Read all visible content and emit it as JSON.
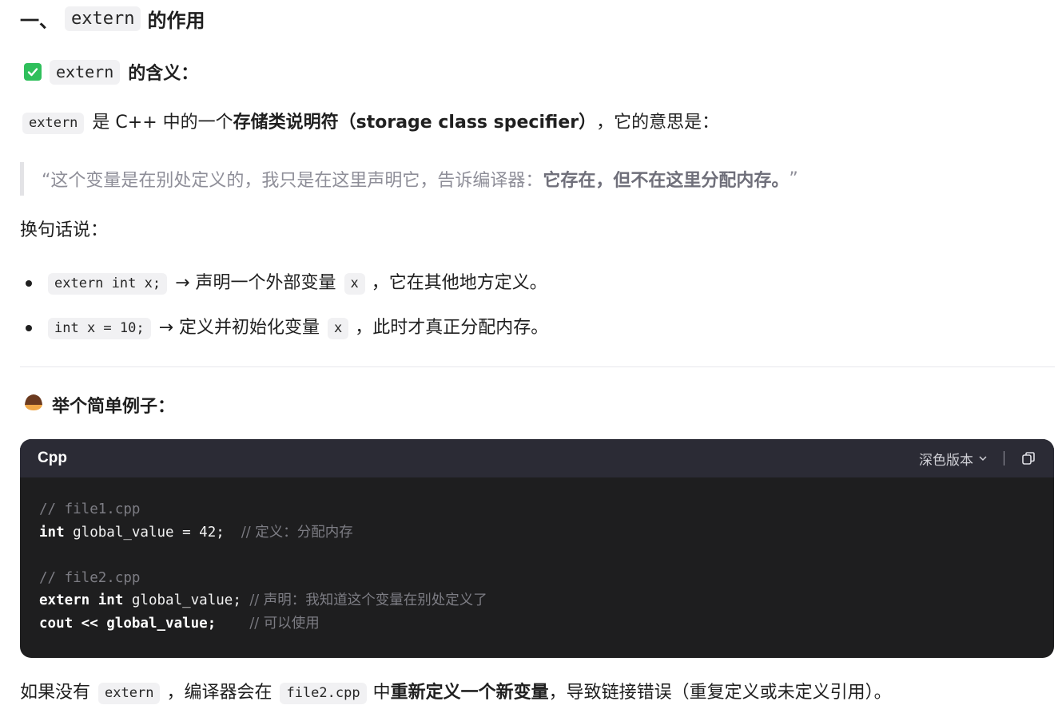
{
  "heading": {
    "prefix": "一、",
    "code": "extern",
    "suffix": "的作用"
  },
  "meaning": {
    "code": "extern",
    "title": "的含义："
  },
  "intro": {
    "code": "extern",
    "text1": "是 C++ 中的一个",
    "bold": "存储类说明符（storage class specifier）",
    "text2": "，它的意思是："
  },
  "quote": {
    "text": "“这个变量是在别处定义的，我只是在这里声明它，告诉编译器：",
    "bold": "它存在，但不在这里分配内存。",
    "close": "”"
  },
  "in_other_words": "换句话说：",
  "bullets": [
    {
      "code": "extern int x;",
      "text1": "→ 声明一个外部变量",
      "var": "x",
      "text2": "，它在其他地方定义。"
    },
    {
      "code": "int x = 10;",
      "text1": "→ 定义并初始化变量",
      "var": "x",
      "text2": "，此时才真正分配内存。"
    }
  ],
  "example": {
    "title": "举个简单例子：",
    "icon": "chestnut-icon"
  },
  "codeblock": {
    "lang": "Cpp",
    "theme_label": "深色版本",
    "lines": [
      {
        "comment": "// file1.cpp"
      },
      {
        "kw": "int",
        "code": " global_value = 42;  ",
        "comment_cn": "// 定义：分配内存"
      },
      {
        "blank": true
      },
      {
        "comment": "// file2.cpp"
      },
      {
        "kw": "extern int",
        "code": " global_value; ",
        "comment_cn": "// 声明：我知道这个变量在别处定义了"
      },
      {
        "code": "cout << global_value;    ",
        "comment_cn": "// 可以使用"
      }
    ]
  },
  "footer": {
    "text1": "如果没有",
    "code1": "extern",
    "text2": "，编译器会在",
    "code2": "file2.cpp",
    "text3": "中",
    "bold": "重新定义一个新变量",
    "text4": "，导致链接错误（重复定义或未定义引用）。"
  },
  "colors": {
    "check": "#2fbf5b",
    "code_bg": "#1e1e1f",
    "code_head": "#2b2b35"
  }
}
